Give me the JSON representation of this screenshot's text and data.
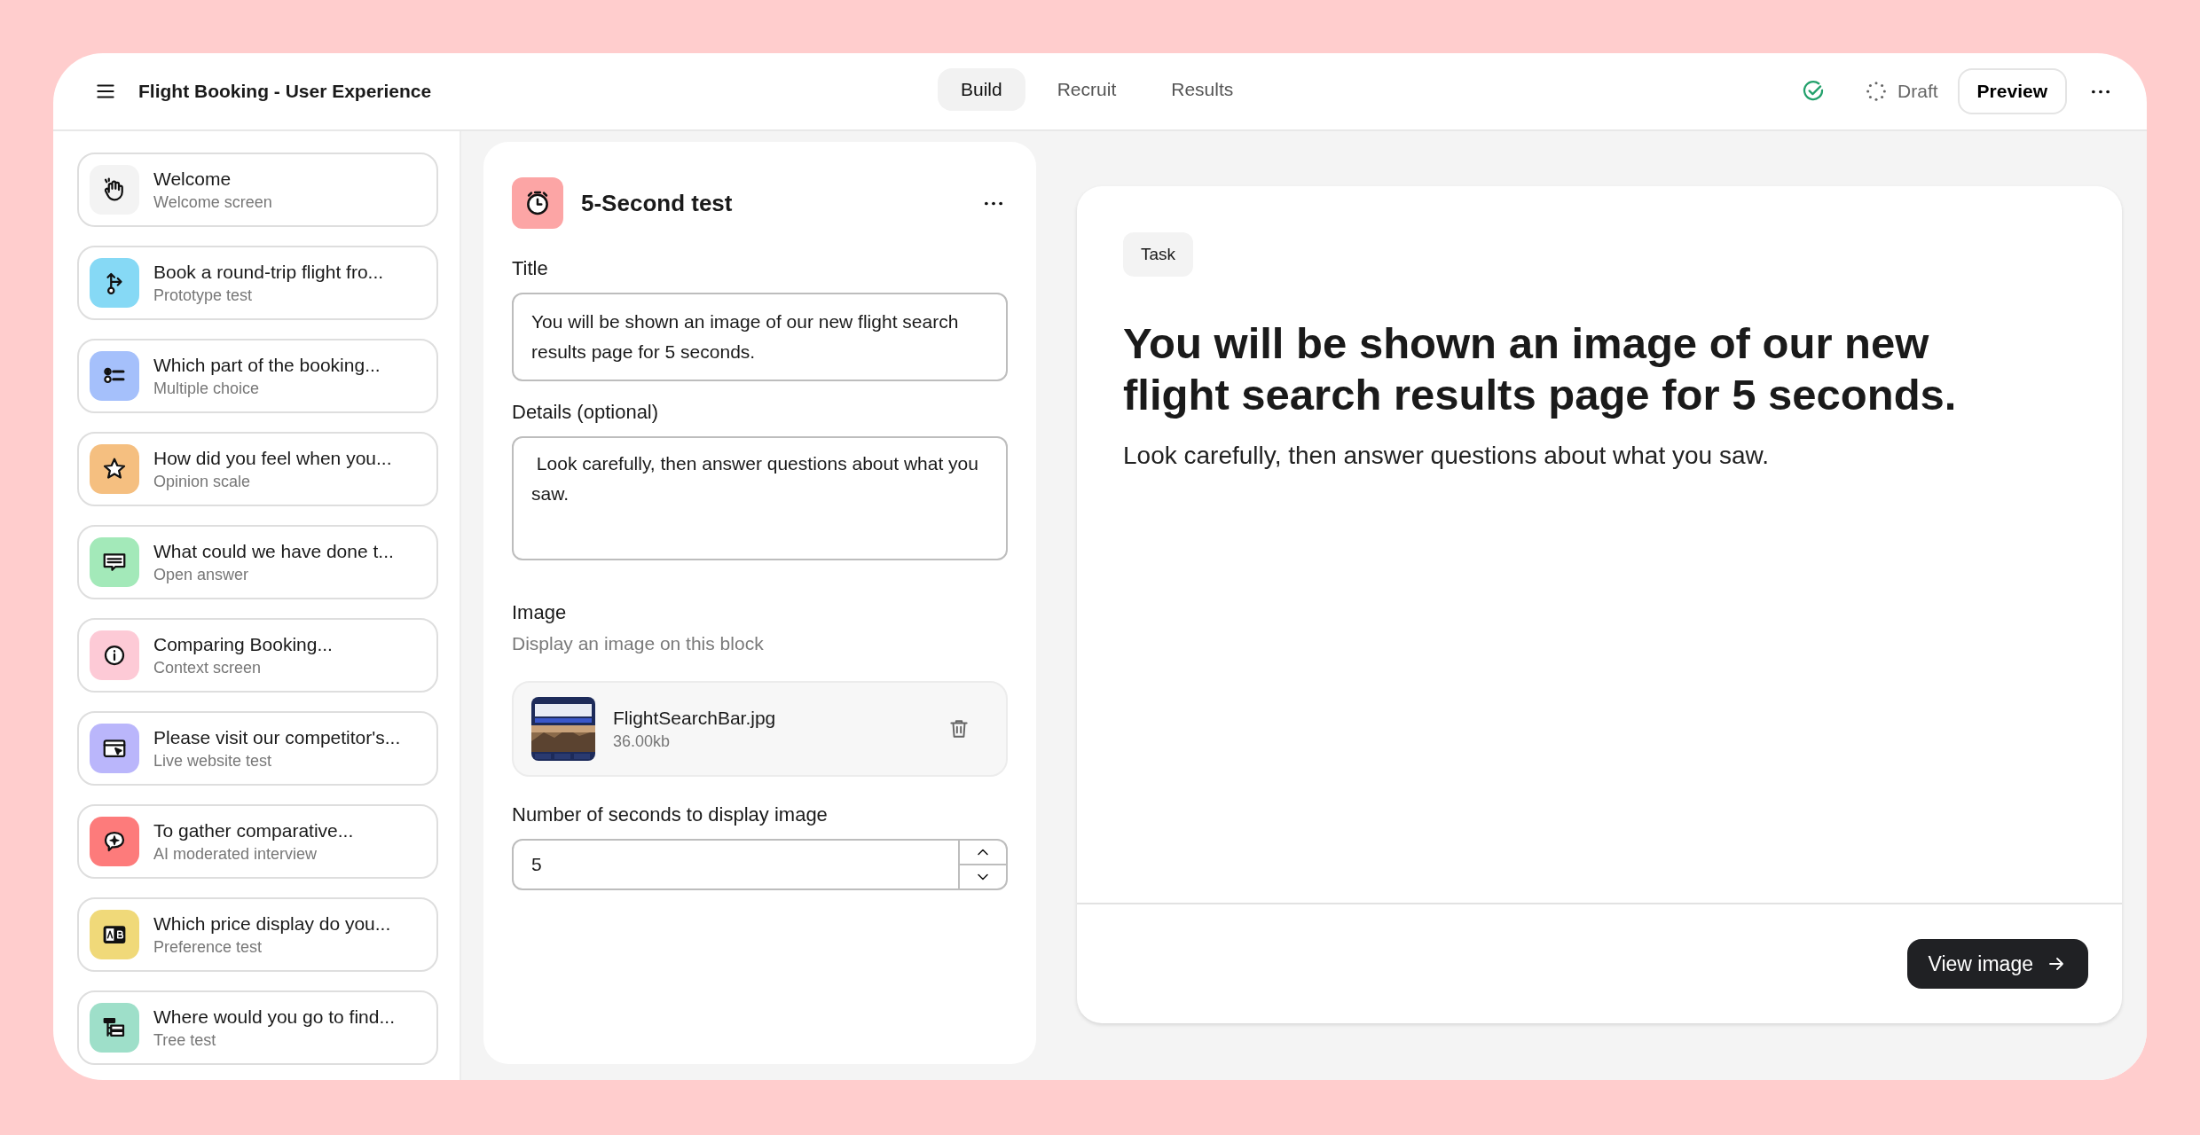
{
  "header": {
    "title": "Flight Booking - User Experience",
    "tabs": [
      {
        "label": "Build",
        "selected": true
      },
      {
        "label": "Recruit",
        "selected": false
      },
      {
        "label": "Results",
        "selected": false
      }
    ],
    "status": "Draft",
    "preview_button": "Preview"
  },
  "sidebar": {
    "items": [
      {
        "title": "Welcome",
        "subtitle": "Welcome screen",
        "kind": "welcome",
        "color": "#f3f3f3"
      },
      {
        "title": "Book a round-trip flight fro...",
        "subtitle": "Prototype test",
        "kind": "prototype",
        "color": "#86d9f5"
      },
      {
        "title": "Which part of the booking...",
        "subtitle": "Multiple choice",
        "kind": "choice",
        "color": "#a5c0fb"
      },
      {
        "title": "How did you feel when you...",
        "subtitle": "Opinion scale",
        "kind": "opinion",
        "color": "#f5bf80"
      },
      {
        "title": "What could we have done t...",
        "subtitle": "Open answer",
        "kind": "open",
        "color": "#a3e9b9"
      },
      {
        "title": "Comparing Booking...",
        "subtitle": "Context screen",
        "kind": "context",
        "color": "#fdcad6"
      },
      {
        "title": "Please visit our competitor's...",
        "subtitle": "Live website test",
        "kind": "website",
        "color": "#bab6fb"
      },
      {
        "title": "To gather comparative...",
        "subtitle": "AI moderated interview",
        "kind": "interview",
        "color": "#fd7b7b"
      },
      {
        "title": "Which price display do you...",
        "subtitle": "Preference test",
        "kind": "preference",
        "color": "#f0d979"
      },
      {
        "title": "Where would you go to find...",
        "subtitle": "Tree test",
        "kind": "tree",
        "color": "#9edfc9"
      }
    ]
  },
  "editor": {
    "block_title": "5-Second test",
    "title_label": "Title",
    "title_value": "You will be shown an image of our new flight search results page for 5 seconds.",
    "details_label": "Details (optional)",
    "details_value": " Look carefully, then answer questions about what you saw.",
    "image_label": "Image",
    "image_hint": "Display an image on this block",
    "file": {
      "name": "FlightSearchBar.jpg",
      "size": "36.00kb",
      "kind": "picture"
    },
    "seconds_label": "Number of seconds to display image",
    "seconds_value": "5"
  },
  "preview": {
    "tag": "Task",
    "heading": "You will be shown an image of our new flight search results page for 5 seconds.",
    "body": "Look carefully, then answer questions about what you saw.",
    "button": "View image"
  }
}
